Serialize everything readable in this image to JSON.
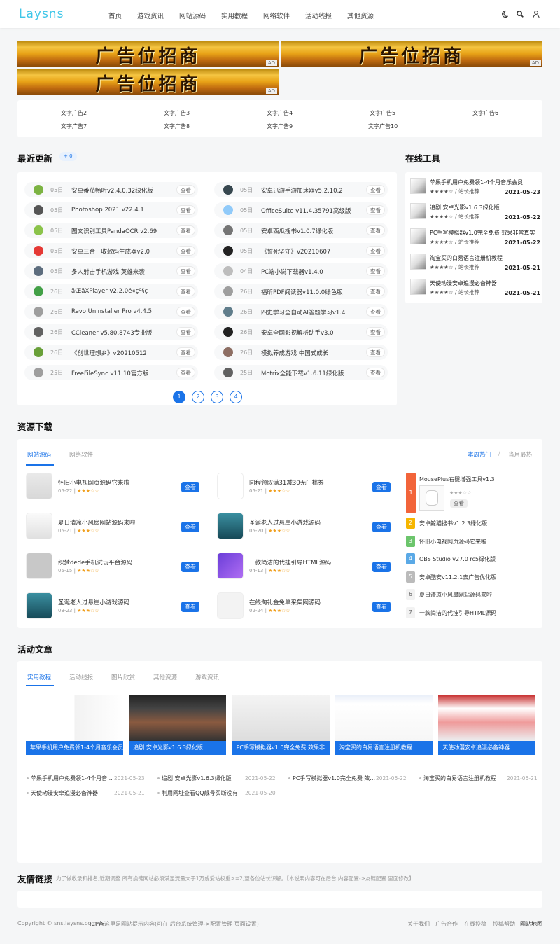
{
  "header": {
    "logo": "Laysns",
    "nav": [
      "首页",
      "游戏资讯",
      "网站源码",
      "实用教程",
      "网络软件",
      "活动线报",
      "其他资源"
    ]
  },
  "ads": {
    "banner_text": "广告位招商",
    "tag": "AD"
  },
  "text_ads": [
    "文字广告2",
    "文字广告3",
    "文字广告4",
    "文字广告5",
    "文字广告6",
    "文字广告7",
    "文字广告8",
    "文字广告9",
    "文字广告10"
  ],
  "recent": {
    "title": "最近更新",
    "badge": "+ 0",
    "view_label": "查看",
    "left": [
      {
        "date": "05日",
        "name": "安卓番茄畅听v2.4.0.32绿化版",
        "color": "#7cb342"
      },
      {
        "date": "05日",
        "name": "Photoshop 2021 v22.4.1",
        "color": "#555"
      },
      {
        "date": "05日",
        "name": "图文识别工具PandaOCR v2.69",
        "color": "#8bc34a"
      },
      {
        "date": "05日",
        "name": "安卓三合一收款码生成器v2.0",
        "color": "#e53935"
      },
      {
        "date": "05日",
        "name": "多人射击手机游戏 英雄来袭",
        "color": "#5d6d7e"
      },
      {
        "date": "26日",
        "name": "åŒåXPlayer v2.2.0é«çº§ç",
        "color": "#43a047"
      },
      {
        "date": "26日",
        "name": "Revo Uninstaller Pro v4.4.5",
        "color": "#9e9e9e"
      },
      {
        "date": "26日",
        "name": "CCleaner v5.80.8743专业版",
        "color": "#616161"
      },
      {
        "date": "26日",
        "name": "《创世理想乡》v20210512",
        "color": "#689f38"
      },
      {
        "date": "25日",
        "name": "FreeFileSync v11.10官方版",
        "color": "#9e9e9e"
      }
    ],
    "right": [
      {
        "date": "05日",
        "name": "安卓迅游手游加速器v5.2.10.2",
        "color": "#37474f"
      },
      {
        "date": "05日",
        "name": "OfficeSuite v11.4.35791高级版",
        "color": "#90caf9"
      },
      {
        "date": "05日",
        "name": "安卓西瓜搜书v1.0.7绿化版",
        "color": "#757575"
      },
      {
        "date": "05日",
        "name": "《誓死坚守》v20210607",
        "color": "#212121"
      },
      {
        "date": "04日",
        "name": "PC端小说下载器v1.4.0",
        "color": "#bdbdbd"
      },
      {
        "date": "26日",
        "name": "福昕PDF阅读器v11.0.0绿色版",
        "color": "#9e9e9e"
      },
      {
        "date": "26日",
        "name": "四史学习全自动AI答题学习v1.4",
        "color": "#607d8b"
      },
      {
        "date": "26日",
        "name": "安卓全网影视解析助手v3.0",
        "color": "#212121"
      },
      {
        "date": "26日",
        "name": "模拟养成游戏 中国式成长",
        "color": "#8d6e63"
      },
      {
        "date": "25日",
        "name": "Motrix全能下载v1.6.11绿化版",
        "color": "#616161"
      }
    ],
    "pages": [
      "1",
      "2",
      "3",
      "4"
    ]
  },
  "tools": {
    "title": "在线工具",
    "items": [
      {
        "name": "苹果手机用户免费领1-4个月音乐会员",
        "sub": "★★★★☆ / 站长推荐",
        "date": "2021-05-23"
      },
      {
        "name": "追剧 安卓光影v1.6.3绿化版",
        "sub": "★★★★☆ / 站长推荐",
        "date": "2021-05-22"
      },
      {
        "name": "PC手写模拟器v1.0完全免费 效果非常真实",
        "sub": "★★★★☆ / 站长推荐",
        "date": "2021-05-22"
      },
      {
        "name": "淘宝买的白易语言注册机教程",
        "sub": "★★★★☆ / 站长推荐",
        "date": "2021-05-21"
      },
      {
        "name": "天使动漫安卓追漫必备神器",
        "sub": "★★★★☆ / 站长推荐",
        "date": "2021-05-21"
      }
    ]
  },
  "downloads": {
    "title": "资源下载",
    "tabs": [
      "网站源码",
      "网络软件"
    ],
    "rank_tabs": [
      "本周热门",
      "/",
      "当月最热"
    ],
    "view_label": "查看",
    "items": [
      {
        "name": "怀旧小电视网页源码它来啦",
        "date": "05-22",
        "stars": "★★★☆☆"
      },
      {
        "name": "同程领取满31减30无门槛券",
        "date": "05-21",
        "stars": "★★★☆☆"
      },
      {
        "name": "夏日清凉小风扇网站源码来啦",
        "date": "05-21",
        "stars": "★★★☆☆"
      },
      {
        "name": "圣诞老人过悬崖小游戏源码",
        "date": "05-20",
        "stars": "★★★☆☆"
      },
      {
        "name": "织梦dede手机试玩平台源码",
        "date": "05-15",
        "stars": "★★★☆☆"
      },
      {
        "name": "一款简洁的代挂引导HTML源码",
        "date": "04-13",
        "stars": "★★★☆☆"
      },
      {
        "name": "圣诞老人过悬崖小游戏源码",
        "date": "03-23",
        "stars": "★★★☆☆"
      },
      {
        "name": "在线淘礼金免单采集网源码",
        "date": "02-24",
        "stars": "★★★☆☆"
      }
    ],
    "rank_top": {
      "num": "1",
      "name": "MousePlus右键增强工具v1.3",
      "stars": "★★★☆☆",
      "view": "查看"
    },
    "rank": [
      {
        "num": "2",
        "name": "安卓鲸猫搜书v1.2.3绿化版",
        "color": "#f6b600"
      },
      {
        "num": "3",
        "name": "怀旧小电视网页源码它来啦",
        "color": "#6cc56c"
      },
      {
        "num": "4",
        "name": "OBS Studio v27.0 rc5绿化版",
        "color": "#5aa9e6"
      },
      {
        "num": "5",
        "name": "安卓酷安v11.2.1去广告优化版",
        "color": "#bbbbbb"
      },
      {
        "num": "6",
        "name": "夏日清凉小风扇网站源码来啦",
        "color": "#f2f2f2"
      },
      {
        "num": "7",
        "name": "一款简洁的代挂引导HTML源码",
        "color": "#f2f2f2"
      }
    ]
  },
  "articles": {
    "title": "活动文章",
    "tabs": [
      "实用教程",
      "活动线报",
      "图片欣赏",
      "其他资源",
      "游戏资讯"
    ],
    "cards": [
      "苹果手机用户免费领1-4个月音乐会员",
      "追剧 安卓光影v1.6.3绿化版",
      "PC手写模拟器v1.0完全免费 效果非...",
      "淘宝买的白易语言注册机教程",
      "天使动漫安卓追漫必备神器"
    ],
    "list": [
      {
        "name": "苹果手机用户免费领1-4个月音...",
        "date": "2021-05-23"
      },
      {
        "name": "追剧 安卓光影v1.6.3绿化版",
        "date": "2021-05-22"
      },
      {
        "name": "PC手写模拟器v1.0完全免费 效...",
        "date": "2021-05-22"
      },
      {
        "name": "淘宝买的白易语言注册机教程",
        "date": "2021-05-21"
      },
      {
        "name": "天使动漫安卓追漫必备神器",
        "date": "2021-05-21"
      },
      {
        "name": "利用网址查看QQ靓号买断没有",
        "date": "2021-05-20"
      }
    ]
  },
  "links": {
    "title": "友情链接",
    "note": "为了做收录和排名,近期调整 所有换链网站必须满足流量大于1万或爱站权重>=2,望各位站长谅解。【本说明内容可在后台 内容配置->友链配置 里面修改】"
  },
  "footer": {
    "copyright": "Copyright © sns.laysns.com",
    "icp": "ICP备",
    "notice": "这里是网站提示内容(可在 后台系统管理->配置管理 页面设置)",
    "links": [
      "关于我们",
      "广告合作",
      "在线投稿",
      "投稿帮助",
      "网站地图"
    ]
  }
}
